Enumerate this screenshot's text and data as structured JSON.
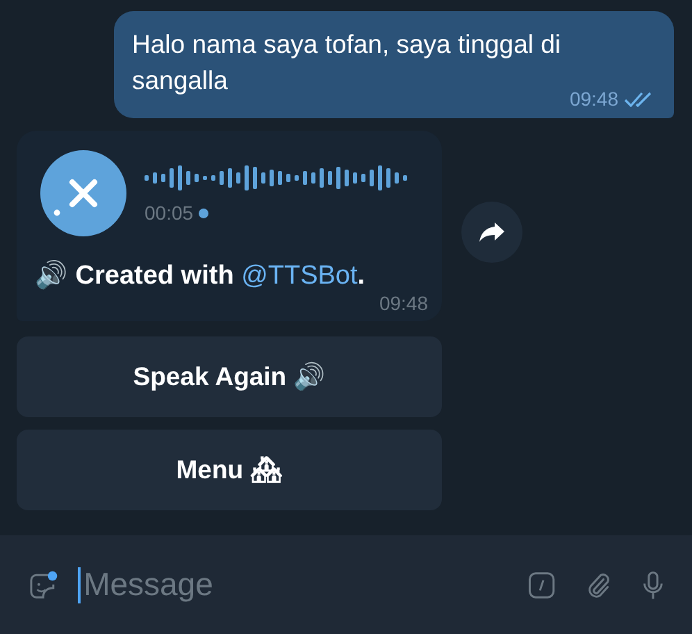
{
  "messages": [
    {
      "kind": "outgoing",
      "text": "Halo nama saya tofan, saya tinggal di sangalla",
      "time": "09:48",
      "read": true
    },
    {
      "kind": "voice",
      "duration": "00:05",
      "caption_prefix": "🔊 Created with ",
      "caption_link": "@TTSBot",
      "caption_suffix": ".",
      "time": "09:48"
    }
  ],
  "bot_buttons": [
    {
      "label": "Speak Again 🔊"
    },
    {
      "label": "Menu 🏘"
    }
  ],
  "composer": {
    "placeholder": "Message"
  }
}
